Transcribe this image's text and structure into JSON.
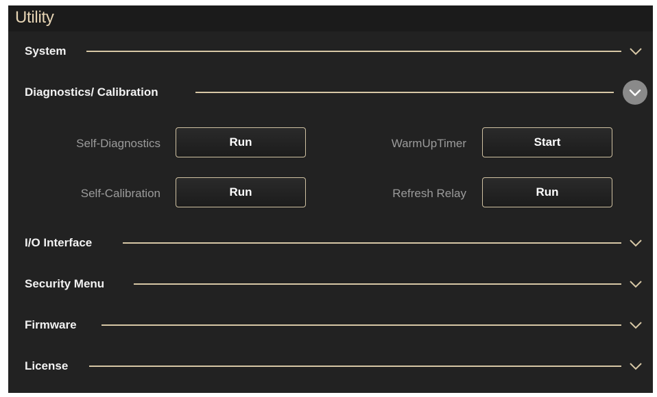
{
  "window": {
    "title": "Utility"
  },
  "sections": {
    "system": {
      "label": "System"
    },
    "diagnostics": {
      "label": "Diagnostics/ Calibration",
      "rows": {
        "self_diagnostics": {
          "label": "Self-Diagnostics",
          "button": "Run"
        },
        "warm_up_timer": {
          "label": "WarmUpTimer",
          "button": "Start"
        },
        "self_calibration": {
          "label": "Self-Calibration",
          "button": "Run"
        },
        "refresh_relay": {
          "label": "Refresh Relay",
          "button": "Run"
        }
      }
    },
    "io_interface": {
      "label": "I/O Interface"
    },
    "security_menu": {
      "label": "Security Menu"
    },
    "firmware": {
      "label": "Firmware"
    },
    "license": {
      "label": "License"
    }
  },
  "icons": {
    "collapsed": "chevron-down-icon",
    "expanded": "chevron-down-circle-icon"
  },
  "colors": {
    "background": "#222222",
    "title_text": "#e6d4b4",
    "divider": "#d8c8a6",
    "button_border": "#d1c3a3",
    "muted_label": "#9b9b9b"
  }
}
